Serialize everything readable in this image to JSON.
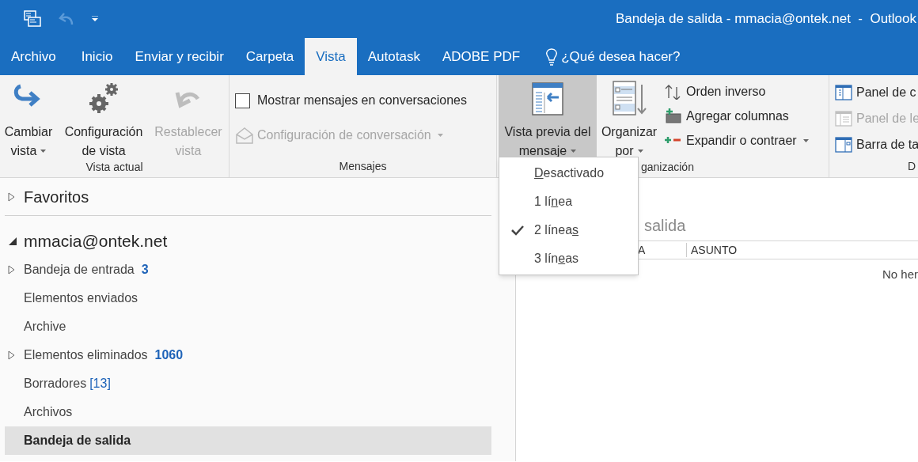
{
  "window": {
    "title": "Bandeja de salida - mmacia@ontek.net  -  Outlook"
  },
  "tabs": [
    {
      "label": "Archivo",
      "selected": false
    },
    {
      "label": "Inicio",
      "selected": false
    },
    {
      "label": "Enviar y recibir",
      "selected": false
    },
    {
      "label": "Carpeta",
      "selected": false
    },
    {
      "label": "Vista",
      "selected": true
    },
    {
      "label": "Autotask",
      "selected": false
    },
    {
      "label": "ADOBE PDF",
      "selected": false
    }
  ],
  "tell_me": {
    "placeholder": "¿Qué desea hacer?"
  },
  "ribbon": {
    "current_view": {
      "label": "Vista actual",
      "buttons": [
        {
          "lines": [
            "Cambiar",
            "vista"
          ],
          "dropdown": true,
          "disabled": false
        },
        {
          "lines": [
            "Configuración",
            "de vista"
          ],
          "dropdown": false,
          "disabled": false
        },
        {
          "lines": [
            "Restablecer",
            "vista"
          ],
          "dropdown": false,
          "disabled": true
        }
      ]
    },
    "messages": {
      "label": "Mensajes",
      "checkbox": {
        "label": "Mostrar mensajes en conversaciones",
        "checked": false
      },
      "menu": {
        "label": "Configuración de conversación",
        "dropdown": true,
        "disabled": true
      }
    },
    "arrangement": {
      "label": "ganización",
      "buttons": [
        {
          "lines": [
            "Vista previa del",
            "mensaje"
          ],
          "dropdown": true,
          "expanded": true
        },
        {
          "lines": [
            "Organizar",
            "por"
          ],
          "dropdown": true,
          "expanded": false
        }
      ],
      "commands": [
        {
          "label": "Orden inverso",
          "dropdown": false
        },
        {
          "label": "Agregar columnas",
          "dropdown": false
        },
        {
          "label": "Expandir o contraer",
          "dropdown": true
        }
      ]
    },
    "layout": {
      "label": "D",
      "commands": [
        {
          "label": "Panel de c",
          "disabled": false
        },
        {
          "label": "Panel de le",
          "disabled": true
        },
        {
          "label": "Barra de ta",
          "disabled": false
        }
      ]
    }
  },
  "preview_menu": [
    {
      "checked": false,
      "segments": [
        {
          "text": "D",
          "underline": true
        },
        {
          "text": "esactivado",
          "underline": false
        }
      ]
    },
    {
      "checked": false,
      "segments": [
        {
          "text": "1 lí",
          "underline": false
        },
        {
          "text": "n",
          "underline": true
        },
        {
          "text": "ea",
          "underline": false
        }
      ]
    },
    {
      "checked": true,
      "segments": [
        {
          "text": "2 línea",
          "underline": false
        },
        {
          "text": "s",
          "underline": true
        }
      ]
    },
    {
      "checked": false,
      "segments": [
        {
          "text": "3 lín",
          "underline": false
        },
        {
          "text": "e",
          "underline": true
        },
        {
          "text": "as",
          "underline": false
        }
      ]
    }
  ],
  "sidebar": {
    "favorites": {
      "label": "Favoritos",
      "expanded": false
    },
    "account": {
      "label": "mmacia@ontek.net",
      "expanded": true
    },
    "folders": [
      {
        "label": "Bandeja de entrada",
        "count": "3",
        "count_unread": true,
        "expandable": true,
        "selected": false
      },
      {
        "label": "Elementos enviados",
        "expandable": false,
        "selected": false
      },
      {
        "label": "Archive",
        "expandable": false,
        "selected": false
      },
      {
        "label": "Elementos eliminados",
        "count": "1060",
        "count_unread": true,
        "expandable": true,
        "selected": false
      },
      {
        "label": "Borradores",
        "count": "[13]",
        "count_unread": false,
        "expandable": false,
        "selected": false
      },
      {
        "label": "Archivos",
        "expandable": false,
        "selected": false
      },
      {
        "label": "Bandeja de salida",
        "expandable": false,
        "selected": true
      }
    ]
  },
  "message_list": {
    "folder_title": "salida",
    "columns": [
      "A",
      "ASUNTO"
    ],
    "empty_message": "No her"
  }
}
